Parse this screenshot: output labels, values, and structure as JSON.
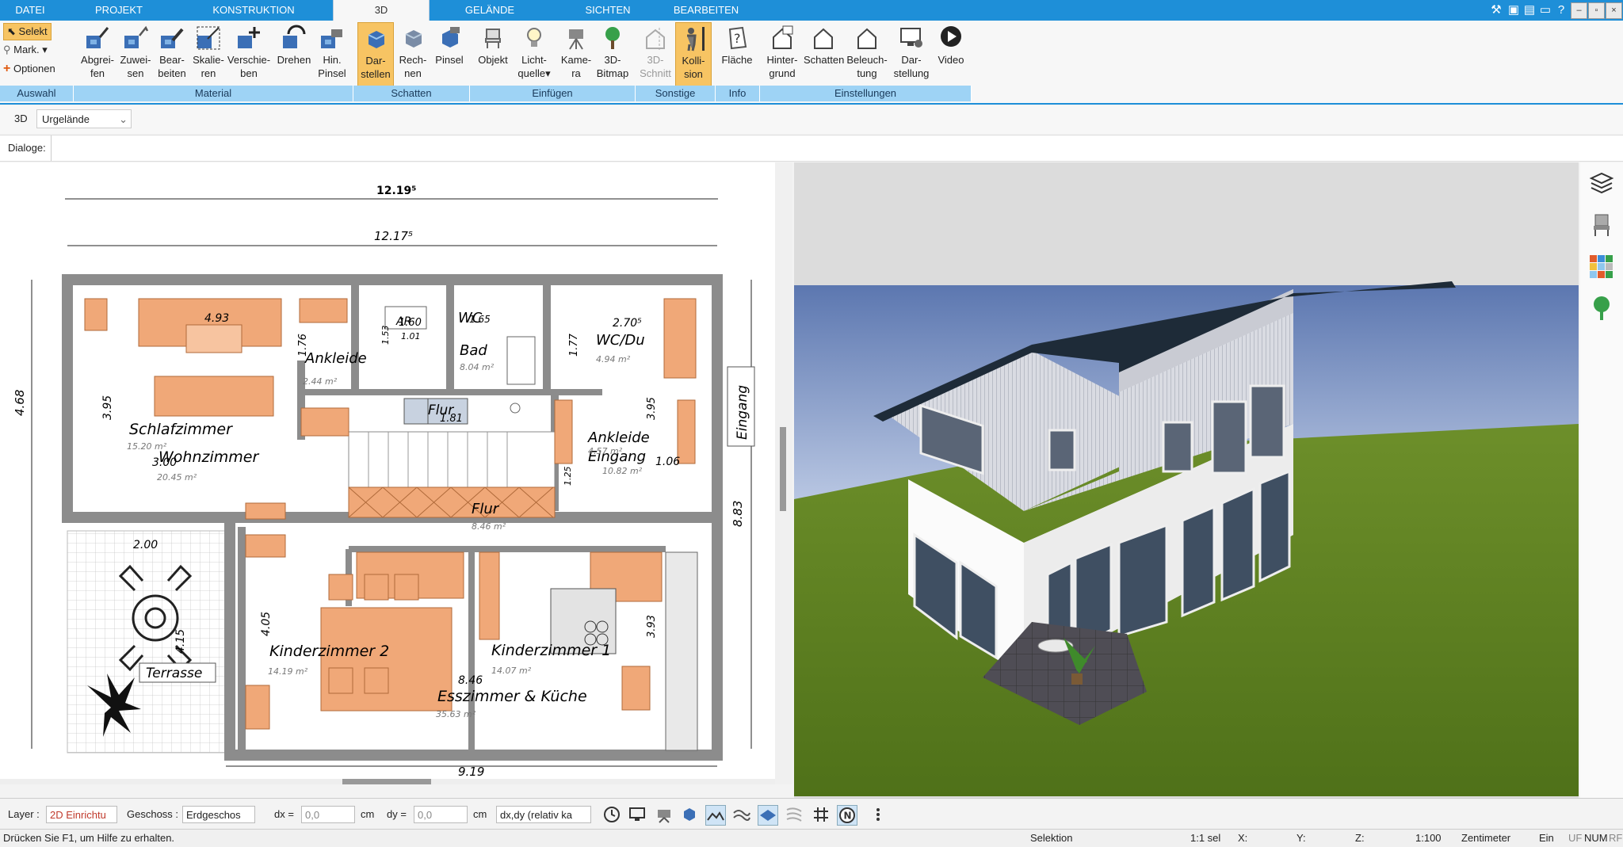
{
  "tabs": [
    "DATEI",
    "PROJEKT",
    "KONSTRUKTION",
    "3D",
    "GELÄNDE",
    "SICHTEN",
    "BEARBEITEN"
  ],
  "ribbon": {
    "auswahl": {
      "select_label": "Selekt",
      "mark_label": "Mark.",
      "options_label": "Optionen",
      "group": "Auswahl"
    },
    "material": {
      "group": "Material",
      "buttons": [
        "Abgrei-\nfen",
        "Zuwei-\nsen",
        "Bear-\nbeiten",
        "Skalie-\nren",
        "Verschie-\nben",
        "Drehen",
        "Hin.\nPinsel"
      ]
    },
    "schatten": {
      "group": "Schatten",
      "buttons": [
        "Dar-\nstellen",
        "Rech-\nnen",
        "Pinsel"
      ]
    },
    "einfuegen": {
      "group": "Einfügen",
      "buttons": [
        "Objekt",
        "Licht-\nquelle",
        "Kame-\nra",
        "3D-\nBitmap"
      ]
    },
    "sonstige": {
      "group": "Sonstige",
      "buttons": [
        "3D-\nSchnitt",
        "Kolli-\nsion"
      ]
    },
    "info": {
      "group": "Info",
      "buttons": [
        "Fläche"
      ]
    },
    "einstellungen": {
      "group": "Einstellungen",
      "buttons": [
        "Hinter-\ngrund",
        "Schatten",
        "Beleuch-\ntung",
        "Dar-\nstellung",
        "Video"
      ]
    }
  },
  "view_row": {
    "mode": "3D",
    "terrain": "Urgelände"
  },
  "dialog_row": {
    "label": "Dialoge:"
  },
  "plan": {
    "dims": {
      "top1": "12.19⁵",
      "top2": "12.17⁵",
      "left_total": "4.68",
      "right_total": "8.83",
      "left_room": "3.95",
      "bottom": "9.19",
      "d493": "4.93",
      "d270": "2.70⁵",
      "d176": "1.76",
      "d177": "1.77",
      "d395b": "3.95",
      "d106": "1.06",
      "d300": "3.00",
      "d200": "2.00",
      "d405": "4.05",
      "d415": "4.15",
      "d393": "3.93",
      "d846": "8.46",
      "d160": "1.60",
      "d181": "1.81",
      "d153": "1.53",
      "d101": "1.01",
      "d016": "1.65",
      "d075": "1.25"
    },
    "rooms": {
      "schlafzimmer": "Schlafzimmer",
      "schlafzimmer_area": "15.20 m²",
      "wohnzimmer": "Wohnzimmer",
      "wohnzimmer_area": "20.45 m²",
      "ankleide1": "Ankleide",
      "ankleide1_area": "2.44 m²",
      "wc1": "WC",
      "bad": "Bad",
      "bad_area": "8.04 m²",
      "wcdu": "WC/Du",
      "wcdu_area": "4.94 m²",
      "flur1": "Flur",
      "ankleide2": "Ankleide",
      "ankleide2_area": "4.57 m²",
      "eingang": "Eingang",
      "eingang_area": "10.82 m²",
      "flur2": "Flur",
      "flur2_area": "8.46 m²",
      "kinder2": "Kinderzimmer 2",
      "kinder2_area": "14.19 m²",
      "kinder1": "Kinderzimmer 1",
      "kinder1_area": "14.07 m²",
      "essen": "Esszimmer & Küche",
      "essen_area": "35.63 m²",
      "terrasse": "Terrasse",
      "eingang_tag": "Eingang",
      "ar": "AR"
    }
  },
  "toolbar": {
    "layer_label": "Layer :",
    "layer_value": "2D Einrichtu",
    "geschoss_label": "Geschoss :",
    "geschoss_value": "Erdgeschos",
    "dx_label": "dx =",
    "dx_value": "0,0",
    "dx_unit": "cm",
    "dy_label": "dy =",
    "dy_value": "0,0",
    "dy_unit": "cm",
    "mode_value": "dx,dy (relativ ka"
  },
  "status": {
    "help": "Drücken Sie F1, um Hilfe zu erhalten.",
    "mode": "Selektion",
    "sel": "1:1 sel",
    "x": "X:",
    "y": "Y:",
    "z": "Z:",
    "scale": "1:100",
    "unit": "Zentimeter",
    "ein": "Ein",
    "uf": "UF",
    "num": "NUM",
    "rf": "RF"
  },
  "colors": {
    "accent": "#1e8fd8",
    "highlight": "#f7c463",
    "furniture": "#f0a878",
    "group_bar": "#9ed3f5"
  }
}
